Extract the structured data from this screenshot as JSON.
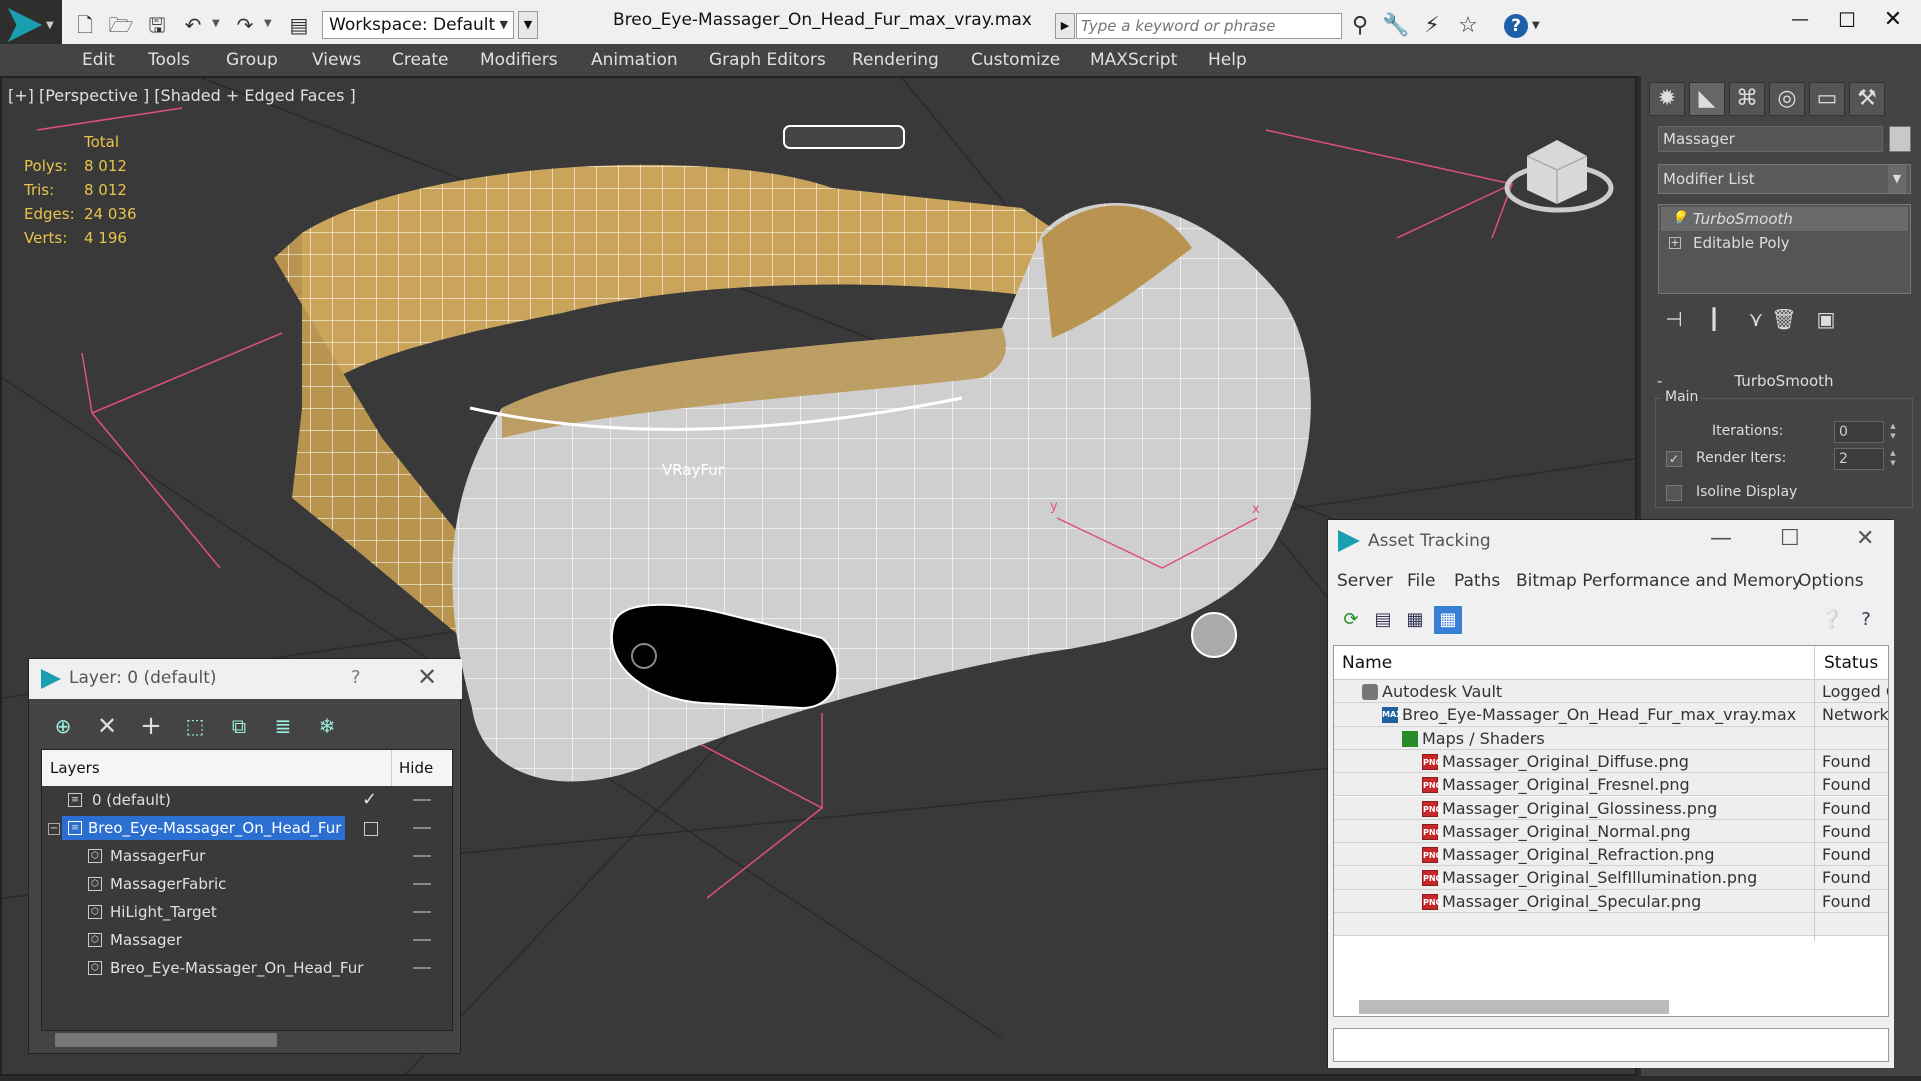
{
  "titlebar": {
    "workspace": "Workspace: Default",
    "document_title": "Breo_Eye-Massager_On_Head_Fur_max_vray.max",
    "search_placeholder": "Type a keyword or phrase",
    "minimize": "—",
    "maximize": "☐",
    "close": "✕",
    "help": "?"
  },
  "menu": {
    "items": [
      "Edit",
      "Tools",
      "Group",
      "Views",
      "Create",
      "Modifiers",
      "Animation",
      "Graph Editors",
      "Rendering",
      "Customize",
      "MAXScript",
      "Help"
    ]
  },
  "viewport": {
    "label": "[+] [Perspective ] [Shaded + Edged Faces ]",
    "stats_header": "Total",
    "stats": [
      {
        "key": "Polys:",
        "value": "8 012"
      },
      {
        "key": "Tris:",
        "value": "8 012"
      },
      {
        "key": "Edges:",
        "value": "24 036"
      },
      {
        "key": "Verts:",
        "value": "4 196"
      }
    ],
    "object_label": "VRayFur",
    "gizmo_labels": {
      "y": "y",
      "x": "x"
    },
    "colors": {
      "helper": "#e0507a",
      "strap": "#c9a45a",
      "shell": "#d0d0d0",
      "grid": "#2a2a2a"
    }
  },
  "command_panel": {
    "object_name": "Massager",
    "modifier_list": "Modifier List",
    "stack": [
      "TurboSmooth",
      "Editable Poly"
    ],
    "rollout_title": "TurboSmooth",
    "rollout_minus": "-",
    "group_main": "Main",
    "iterations_label": "Iterations:",
    "iterations_value": "0",
    "render_iters_label": "Render Iters:",
    "render_iters_value": "2",
    "render_iters_checked": "✓",
    "isoline_label": "Isoline Display"
  },
  "layer_dialog": {
    "title": "Layer: 0 (default)",
    "help": "?",
    "close": "✕",
    "header_layers": "Layers",
    "header_hide": "Hide",
    "rows": [
      {
        "name": "0 (default)",
        "check": "✓"
      },
      {
        "name": "Breo_Eye-Massager_On_Head_Fur",
        "expand": "−"
      },
      {
        "name": "MassagerFur"
      },
      {
        "name": "MassagerFabric"
      },
      {
        "name": "HiLight_Target"
      },
      {
        "name": "Massager"
      },
      {
        "name": "Breo_Eye-Massager_On_Head_Fur"
      }
    ]
  },
  "asset_dialog": {
    "title": "Asset Tracking",
    "minimize": "—",
    "maximize": "☐",
    "close": "✕",
    "menu": [
      "Server",
      "File",
      "Paths",
      "Bitmap Performance and Memory",
      "Options"
    ],
    "header_name": "Name",
    "header_status": "Status",
    "rows": [
      {
        "name": "Autodesk Vault",
        "status": "Logged O",
        "icon": "vault",
        "indent": 1
      },
      {
        "name": "Breo_Eye-Massager_On_Head_Fur_max_vray.max",
        "status": "Network",
        "icon": "max",
        "indent": 2
      },
      {
        "name": "Maps / Shaders",
        "status": "",
        "icon": "folder",
        "indent": 3
      },
      {
        "name": "Massager_Original_Diffuse.png",
        "status": "Found",
        "icon": "png",
        "indent": 4
      },
      {
        "name": "Massager_Original_Fresnel.png",
        "status": "Found",
        "icon": "png",
        "indent": 4
      },
      {
        "name": "Massager_Original_Glossiness.png",
        "status": "Found",
        "icon": "png",
        "indent": 4
      },
      {
        "name": "Massager_Original_Normal.png",
        "status": "Found",
        "icon": "png",
        "indent": 4
      },
      {
        "name": "Massager_Original_Refraction.png",
        "status": "Found",
        "icon": "png",
        "indent": 4
      },
      {
        "name": "Massager_Original_SelfIllumination.png",
        "status": "Found",
        "icon": "png",
        "indent": 4
      },
      {
        "name": "Massager_Original_Specular.png",
        "status": "Found",
        "icon": "png",
        "indent": 4
      }
    ],
    "png_icon_text": "PNG",
    "max_icon_text": "MAX"
  }
}
